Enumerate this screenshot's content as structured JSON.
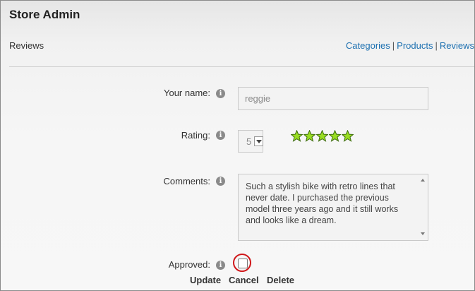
{
  "header": {
    "title": "Store Admin"
  },
  "page": {
    "section_title": "Reviews"
  },
  "nav": {
    "links": [
      "Categories",
      "Products",
      "Reviews"
    ],
    "separator": "|"
  },
  "form": {
    "name_label": "Your name:",
    "name_value": "reggie",
    "rating_label": "Rating:",
    "rating_value": "5",
    "rating_stars": 5,
    "comments_label": "Comments:",
    "comments_value": "Such a stylish bike with retro lines that never date. I purchased the previous model three years ago and it still works and looks like a dream.",
    "approved_label": "Approved:",
    "approved_checked": false,
    "info_glyph": "i"
  },
  "actions": {
    "update": "Update",
    "cancel": "Cancel",
    "delete": "Delete"
  },
  "colors": {
    "link": "#1b6fb0",
    "star": "#99dd22",
    "highlight": "#d0171a"
  }
}
